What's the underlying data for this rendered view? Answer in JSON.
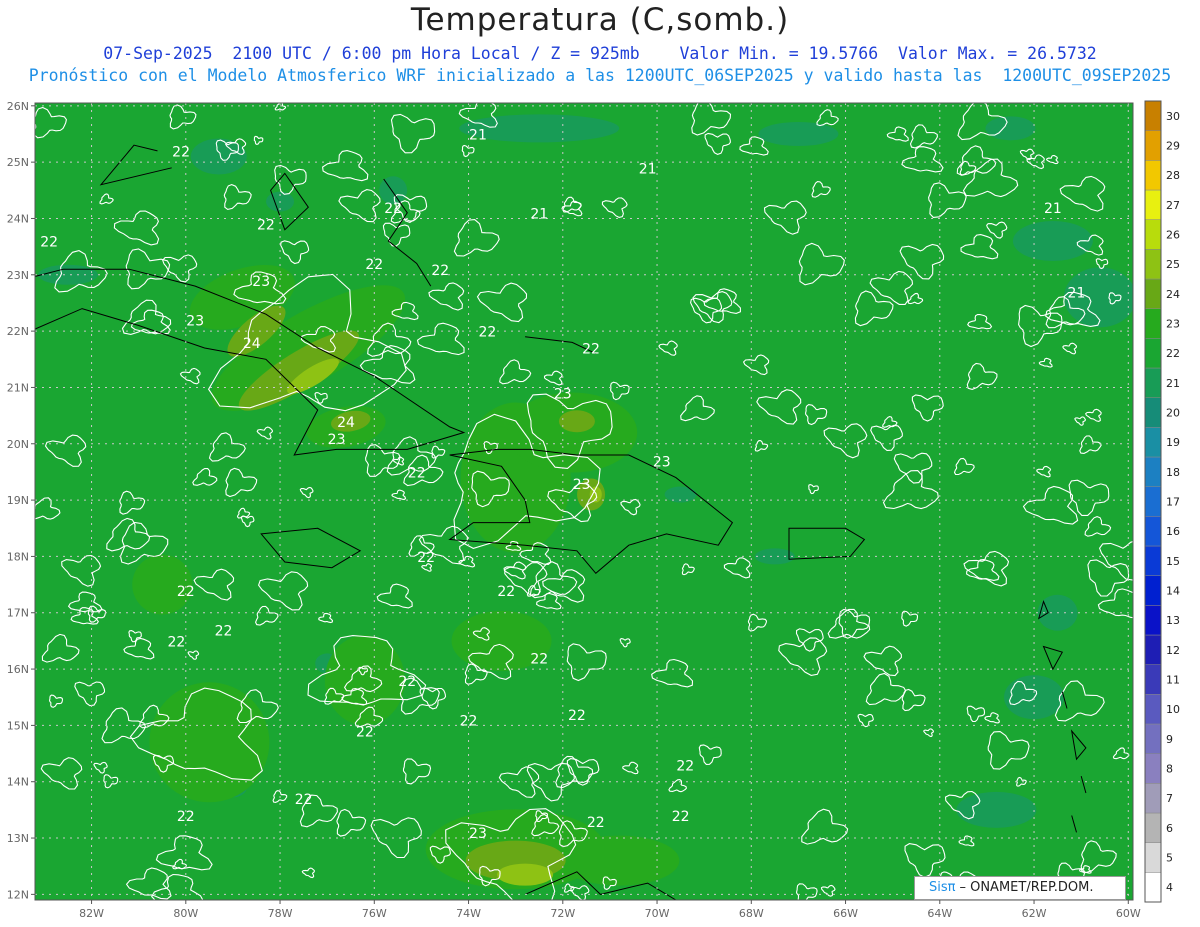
{
  "header": {
    "title": "Temperatura (C,somb.)",
    "line1": "07-Sep-2025  2100 UTC / 6:00 pm Hora Local / Z = 925mb    Valor Min. = 19.5766  Valor Max. = 26.5732",
    "line2": "Pronóstico con el Modelo Atmosferico WRF inicializado a las 1200UTC_06SEP2025 y valido hasta las  1200UTC_09SEP2025"
  },
  "axes": {
    "lat_labels": [
      "26N",
      "25N",
      "24N",
      "23N",
      "22N",
      "21N",
      "20N",
      "19N",
      "18N",
      "17N",
      "16N",
      "15N",
      "14N",
      "13N",
      "12N"
    ],
    "lon_labels": [
      "82W",
      "80W",
      "78W",
      "76W",
      "74W",
      "72W",
      "70W",
      "68W",
      "66W",
      "64W",
      "62W",
      "60W"
    ]
  },
  "contour_labels": [
    {
      "text": "22",
      "lon": -80.1,
      "lat": 25.1
    },
    {
      "text": "21",
      "lon": -73.8,
      "lat": 25.4
    },
    {
      "text": "21",
      "lon": -70.2,
      "lat": 24.8
    },
    {
      "text": "21",
      "lon": -72.5,
      "lat": 24.0
    },
    {
      "text": "22",
      "lon": -78.3,
      "lat": 23.8
    },
    {
      "text": "22",
      "lon": -75.6,
      "lat": 24.1
    },
    {
      "text": "22",
      "lon": -82.9,
      "lat": 23.5
    },
    {
      "text": "22",
      "lon": -76.0,
      "lat": 23.1
    },
    {
      "text": "22",
      "lon": -74.6,
      "lat": 23.0
    },
    {
      "text": "23",
      "lon": -78.4,
      "lat": 22.8
    },
    {
      "text": "21",
      "lon": -61.6,
      "lat": 24.1
    },
    {
      "text": "21",
      "lon": -61.1,
      "lat": 22.6
    },
    {
      "text": "23",
      "lon": -79.8,
      "lat": 22.1
    },
    {
      "text": "22",
      "lon": -73.6,
      "lat": 21.9
    },
    {
      "text": "24",
      "lon": -78.6,
      "lat": 21.7
    },
    {
      "text": "22",
      "lon": -71.4,
      "lat": 21.6
    },
    {
      "text": "23",
      "lon": -72.0,
      "lat": 20.8
    },
    {
      "text": "24",
      "lon": -76.6,
      "lat": 20.3
    },
    {
      "text": "23",
      "lon": -76.8,
      "lat": 20.0
    },
    {
      "text": "22",
      "lon": -75.1,
      "lat": 19.4
    },
    {
      "text": "23",
      "lon": -69.9,
      "lat": 19.6
    },
    {
      "text": "23",
      "lon": -71.6,
      "lat": 19.2
    },
    {
      "text": "22",
      "lon": -74.9,
      "lat": 17.9
    },
    {
      "text": "22",
      "lon": -80.0,
      "lat": 17.3
    },
    {
      "text": "22",
      "lon": -73.2,
      "lat": 17.3
    },
    {
      "text": "22",
      "lon": -79.2,
      "lat": 16.6
    },
    {
      "text": "22",
      "lon": -80.2,
      "lat": 16.4
    },
    {
      "text": "22",
      "lon": -72.5,
      "lat": 16.1
    },
    {
      "text": "22",
      "lon": -75.3,
      "lat": 15.7
    },
    {
      "text": "22",
      "lon": -76.2,
      "lat": 14.8
    },
    {
      "text": "22",
      "lon": -74.0,
      "lat": 15.0
    },
    {
      "text": "22",
      "lon": -71.7,
      "lat": 15.1
    },
    {
      "text": "22",
      "lon": -69.4,
      "lat": 14.2
    },
    {
      "text": "22",
      "lon": -77.5,
      "lat": 13.6
    },
    {
      "text": "22",
      "lon": -80.0,
      "lat": 13.3
    },
    {
      "text": "22",
      "lon": -71.3,
      "lat": 13.2
    },
    {
      "text": "22",
      "lon": -69.5,
      "lat": 13.3
    },
    {
      "text": "23",
      "lon": -73.8,
      "lat": 13.0
    }
  ],
  "colorbar": {
    "levels": [
      "4",
      "5",
      "6",
      "7",
      "8",
      "9",
      "10",
      "11",
      "12",
      "13",
      "14",
      "15",
      "16",
      "17",
      "18",
      "19",
      "20",
      "21",
      "22",
      "23",
      "24",
      "25",
      "26",
      "27",
      "28",
      "29",
      "30"
    ],
    "colors": [
      "#ffffff",
      "#d9d9d9",
      "#b4b4b4",
      "#a09cb8",
      "#8a80bf",
      "#7370bf",
      "#5a5abf",
      "#3a3ab8",
      "#1e1eb4",
      "#0a12c8",
      "#0020d0",
      "#0a3ad6",
      "#1456d8",
      "#1a6ed2",
      "#1c80c2",
      "#1a8fa4",
      "#168c78",
      "#189c56",
      "#1aa632",
      "#26aa1e",
      "#68a816",
      "#8ec214",
      "#b8dc0c",
      "#e8f010",
      "#f2c800",
      "#e2a000",
      "#c88000"
    ]
  },
  "colors": {
    "map_base": "#1aa632",
    "cool_area": "#189c56",
    "warm_area": "#26aa1e",
    "warmer_area": "#68a816",
    "warmest_area": "#8ec214",
    "contour": "#ffffff",
    "coast": "#000000",
    "grid": "#c8c8c8"
  },
  "footer": {
    "brand": "Sisπ",
    "org": "– ONAMET/REP.DOM."
  }
}
